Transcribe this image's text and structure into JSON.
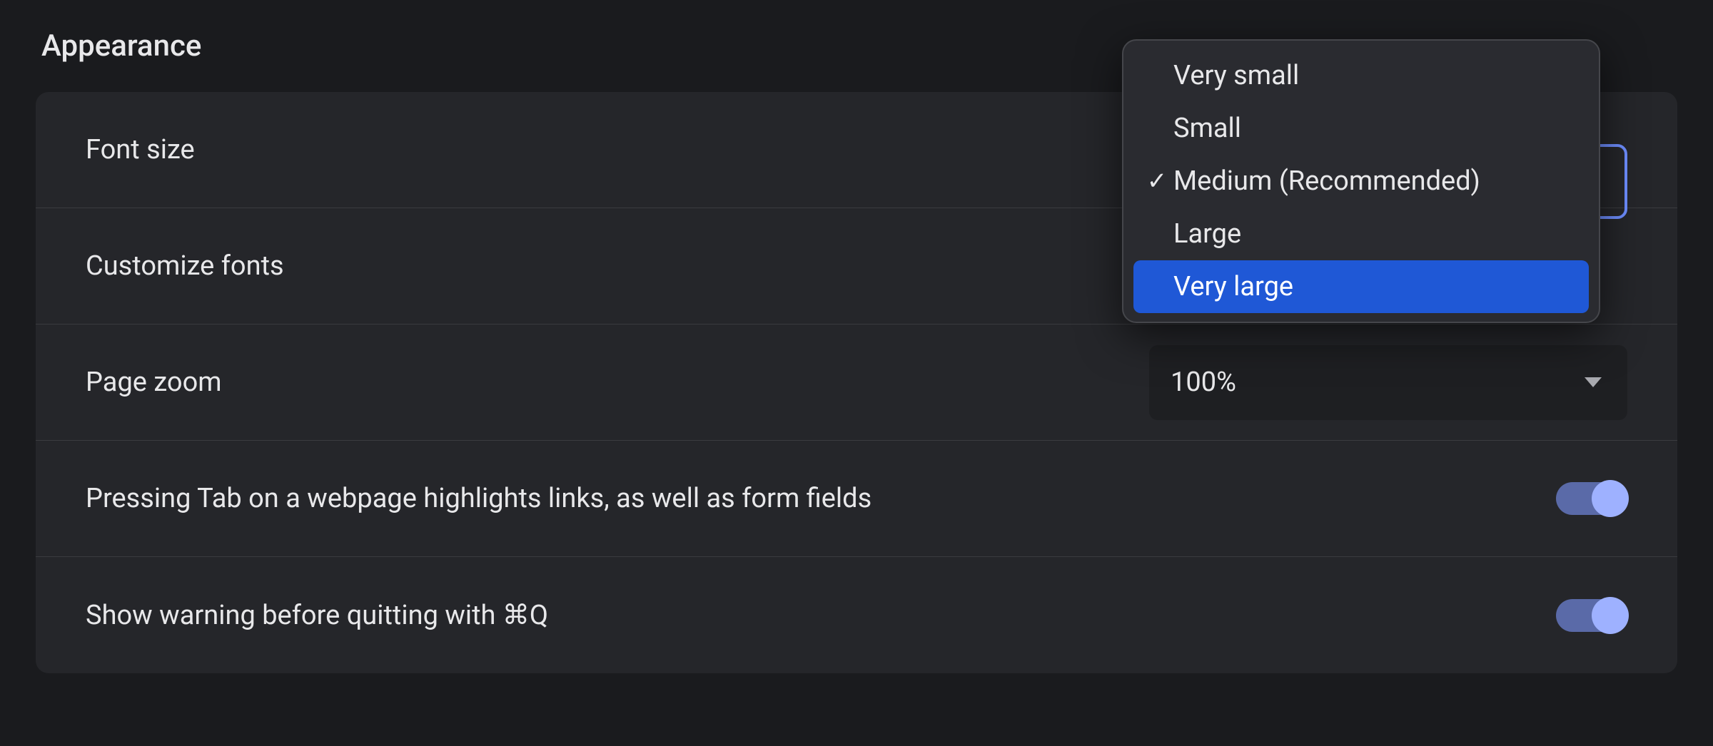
{
  "section_title": "Appearance",
  "rows": {
    "font_size": {
      "label": "Font size"
    },
    "customize_fonts": {
      "label": "Customize fonts"
    },
    "page_zoom": {
      "label": "Page zoom",
      "value": "100%"
    },
    "tab_highlight": {
      "label": "Pressing Tab on a webpage highlights links, as well as form fields",
      "enabled": true
    },
    "warn_quit": {
      "label": "Show warning before quitting with ⌘Q",
      "enabled": true
    }
  },
  "font_size_menu": {
    "options": [
      {
        "label": "Very small",
        "checked": false,
        "highlighted": false
      },
      {
        "label": "Small",
        "checked": false,
        "highlighted": false
      },
      {
        "label": "Medium (Recommended)",
        "checked": true,
        "highlighted": false
      },
      {
        "label": "Large",
        "checked": false,
        "highlighted": false
      },
      {
        "label": "Very large",
        "checked": false,
        "highlighted": true
      }
    ]
  },
  "colors": {
    "accent": "#1f58d6",
    "toggle_track": "#5a6aa8",
    "toggle_knob": "#9eb1ff",
    "focus_ring": "#6e8eff"
  }
}
